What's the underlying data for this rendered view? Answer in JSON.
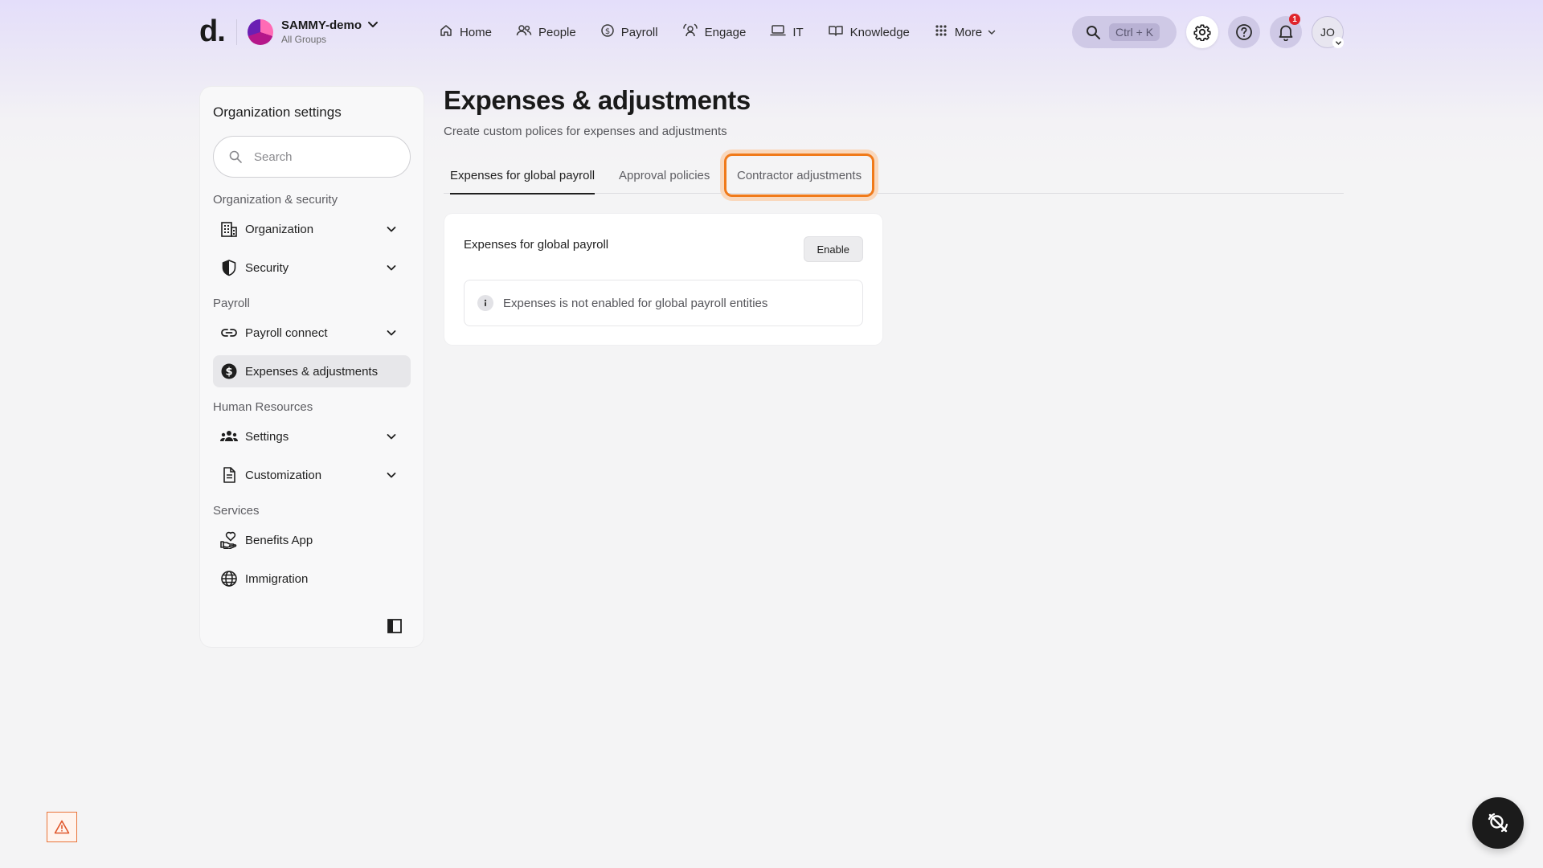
{
  "header": {
    "logo_text": "d.",
    "org": {
      "name": "SAMMY-demo",
      "sub": "All Groups"
    },
    "nav": [
      {
        "label": "Home",
        "icon": "home-icon"
      },
      {
        "label": "People",
        "icon": "people-icon"
      },
      {
        "label": "Payroll",
        "icon": "payroll-icon"
      },
      {
        "label": "Engage",
        "icon": "engage-icon"
      },
      {
        "label": "IT",
        "icon": "laptop-icon"
      },
      {
        "label": "Knowledge",
        "icon": "book-icon"
      },
      {
        "label": "More",
        "icon": "grid-icon"
      }
    ],
    "search_shortcut": "Ctrl + K",
    "notification_count": "1",
    "user_initials": "JO"
  },
  "sidebar": {
    "title": "Organization settings",
    "search_placeholder": "Search",
    "sections": {
      "org_security": "Organization & security",
      "payroll": "Payroll",
      "human_resources": "Human Resources",
      "services": "Services"
    },
    "items": [
      {
        "label": "Organization",
        "icon": "building-icon",
        "expandable": true
      },
      {
        "label": "Security",
        "icon": "shield-icon",
        "expandable": true
      },
      {
        "label": "Payroll connect",
        "icon": "link-icon",
        "expandable": true
      },
      {
        "label": "Expenses & adjustments",
        "icon": "dollar-icon",
        "expandable": false,
        "selected": true
      },
      {
        "label": "Settings",
        "icon": "team-icon",
        "expandable": true
      },
      {
        "label": "Customization",
        "icon": "document-icon",
        "expandable": true
      },
      {
        "label": "Benefits App",
        "icon": "benefits-icon",
        "expandable": false
      },
      {
        "label": "Immigration",
        "icon": "globe-icon",
        "expandable": false
      }
    ]
  },
  "main": {
    "title": "Expenses & adjustments",
    "subtitle": "Create custom polices for expenses and adjustments",
    "tabs": [
      {
        "label": "Expenses for global payroll",
        "active": true
      },
      {
        "label": "Approval policies",
        "active": false
      },
      {
        "label": "Contractor adjustments",
        "active": false,
        "focused": true
      }
    ],
    "card": {
      "title": "Expenses for global payroll",
      "button_label": "Enable",
      "info_text": "Expenses is not enabled for global payroll entities"
    }
  },
  "colors": {
    "focus_ring": "#f07a1a",
    "header_tint": "#e4defa",
    "notification_badge": "#e0242b"
  }
}
